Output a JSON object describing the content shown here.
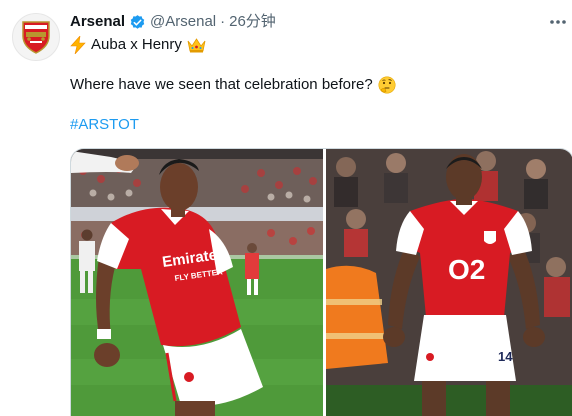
{
  "tweet": {
    "author_name": "Arsenal",
    "verified": true,
    "handle": "@Arsenal",
    "separator": "·",
    "time": "26分钟",
    "line1": "Auba x Henry",
    "line1_leading_emoji": "lightning-emoji",
    "line1_trailing_emoji": "crown-emoji",
    "line2": "Where have we seen that celebration before?",
    "line2_trailing_emoji": "thinking-face-emoji",
    "hashtag": "#ARSTOT"
  },
  "shirt_texts": {
    "sponsor_left": "Emirates",
    "sponsor_left_sub": "FLY BETTER",
    "sponsor_right": "O2",
    "player_number_right": "14"
  },
  "colors": {
    "arsenal_red": "#d81b23",
    "verified_blue": "#1d9bf0",
    "muted_text": "#536471",
    "pitch_green": "#4f9a3a"
  },
  "icons": [
    "arsenal-crest-icon",
    "verified-badge-icon",
    "more-options-icon",
    "lightning-emoji",
    "crown-emoji",
    "thinking-face-emoji"
  ]
}
